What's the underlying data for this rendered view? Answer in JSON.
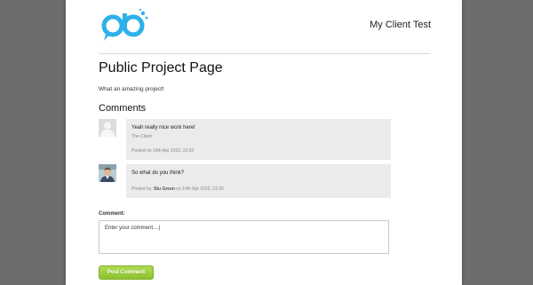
{
  "brand": {
    "logo_icon": "pb-logo",
    "accent": "#2db1e8"
  },
  "header": {
    "client_name": "My Client Test"
  },
  "page": {
    "title": "Public Project Page",
    "intro": "What an amazing project!"
  },
  "comments": {
    "heading": "Comments",
    "items": [
      {
        "text": "Yeah really nice work here!",
        "author": "The Client",
        "meta_text": "Posted on 14th Apr 2010, 21:02",
        "avatar_icon": "default-person-avatar"
      },
      {
        "text": "So what do you think?",
        "meta_prefix": "Posted by: ",
        "meta_author": "Stu Green",
        "meta_suffix": " on 14th Apr 2010, 21:00",
        "avatar_icon": "user-photo-avatar"
      }
    ]
  },
  "form": {
    "label": "Comment:",
    "placeholder": "Enter your comment....",
    "value": "Enter your comment....|",
    "submit_label": "Post Comment",
    "submit_color": "#98c93c"
  }
}
